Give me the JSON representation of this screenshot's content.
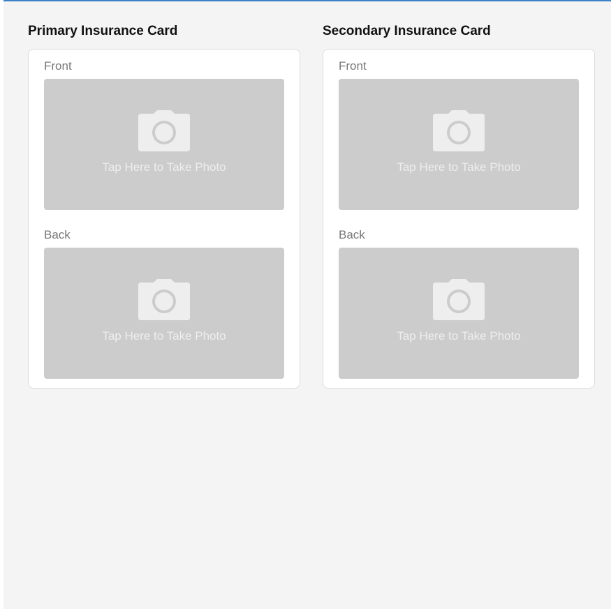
{
  "theme": {
    "accent": "#3b82c4",
    "page_background": "#f4f4f4",
    "card_background": "#ffffff",
    "placeholder_background": "#cccccc",
    "icon_color": "#eeeeee"
  },
  "primary": {
    "title": "Primary Insurance Card",
    "front": {
      "label": "Front",
      "placeholder_text": "Tap Here to Take Photo",
      "icon": "camera-icon"
    },
    "back": {
      "label": "Back",
      "placeholder_text": "Tap Here to Take Photo",
      "icon": "camera-icon"
    }
  },
  "secondary": {
    "title": "Secondary Insurance Card",
    "front": {
      "label": "Front",
      "placeholder_text": "Tap Here to Take Photo",
      "icon": "camera-icon"
    },
    "back": {
      "label": "Back",
      "placeholder_text": "Tap Here to Take Photo",
      "icon": "camera-icon"
    }
  }
}
